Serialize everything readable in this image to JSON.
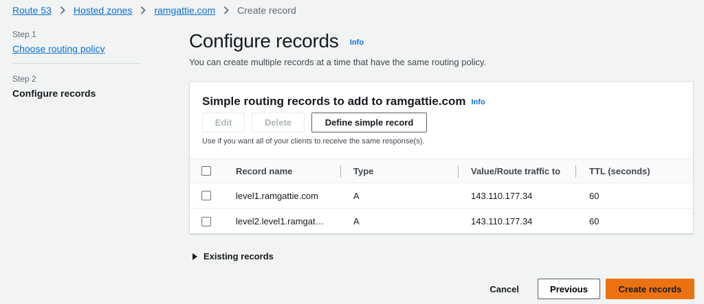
{
  "breadcrumb": {
    "items": [
      "Route 53",
      "Hosted zones",
      "ramgattie.com"
    ],
    "current": "Create record"
  },
  "steps": [
    {
      "label": "Step 1",
      "title": "Choose routing policy"
    },
    {
      "label": "Step 2",
      "title": "Configure records"
    }
  ],
  "header": {
    "title": "Configure records",
    "info": "Info",
    "description": "You can create multiple records at a time that have the same routing policy."
  },
  "panel": {
    "title": "Simple routing records to add to ramgattie.com",
    "info": "Info",
    "buttons": {
      "edit": "Edit",
      "delete": "Delete",
      "define": "Define simple record"
    },
    "help": "Use if you want all of your clients to receive the same response(s).",
    "columns": [
      "Record name",
      "Type",
      "Value/Route traffic to",
      "TTL (seconds)"
    ],
    "rows": [
      {
        "name": "level1.ramgattie.com",
        "type": "A",
        "value": "143.110.177.34",
        "ttl": "60"
      },
      {
        "name": "level2.level1.ramgat…",
        "type": "A",
        "value": "143.110.177.34",
        "ttl": "60"
      }
    ]
  },
  "existing_records": "Existing records",
  "footer": {
    "cancel": "Cancel",
    "previous": "Previous",
    "create": "Create records"
  },
  "colors": {
    "accent": "#ec7211",
    "link": "#0972d3"
  }
}
